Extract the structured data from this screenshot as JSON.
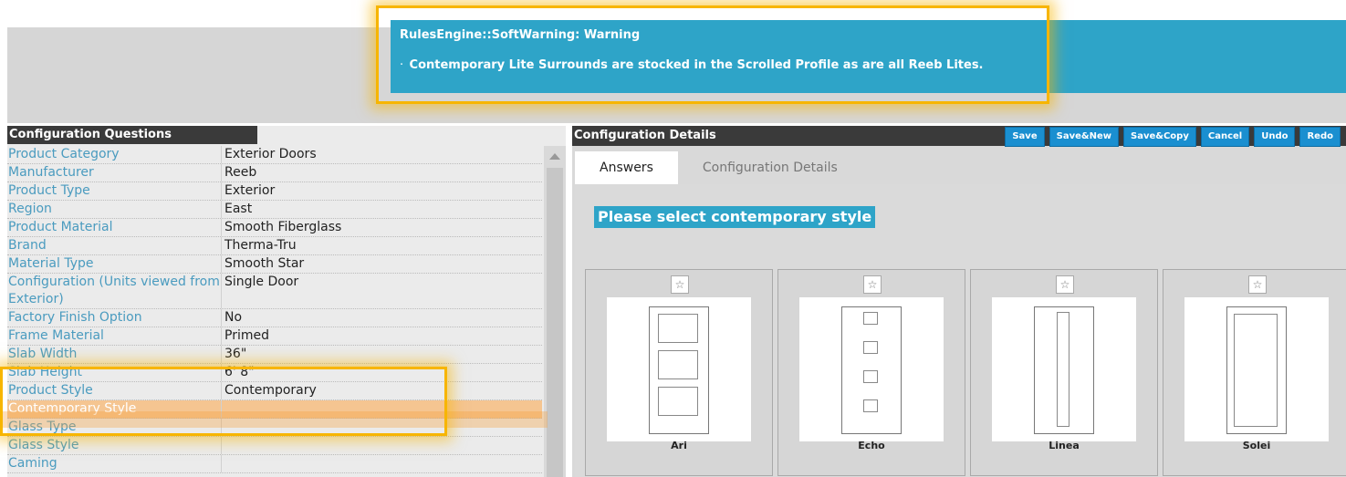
{
  "warning": {
    "title": "RulesEngine::SoftWarning: Warning",
    "message": "Contemporary Lite Surrounds are stocked in the Scrolled Profile as are all Reeb Lites."
  },
  "questions": {
    "header": "Configuration Questions",
    "rows": [
      {
        "q": "Product Category",
        "a": "Exterior Doors"
      },
      {
        "q": "Manufacturer",
        "a": "Reeb"
      },
      {
        "q": "Product Type",
        "a": "Exterior"
      },
      {
        "q": "Region",
        "a": "East"
      },
      {
        "q": "Product Material",
        "a": "Smooth Fiberglass"
      },
      {
        "q": "Brand",
        "a": "Therma-Tru"
      },
      {
        "q": "Material Type",
        "a": "Smooth Star"
      },
      {
        "q": "Configuration (Units viewed from Exterior)",
        "a": "Single Door"
      },
      {
        "q": "Factory Finish Option",
        "a": "No"
      },
      {
        "q": "Frame Material",
        "a": "Primed"
      },
      {
        "q": "Slab Width",
        "a": "36\""
      },
      {
        "q": "Slab Height",
        "a": "6' 8\""
      },
      {
        "q": "Product Style",
        "a": "Contemporary"
      },
      {
        "q": "Contemporary Style",
        "a": ""
      },
      {
        "q": "Glass Type",
        "a": ""
      },
      {
        "q": "Glass Style",
        "a": ""
      },
      {
        "q": "Caming",
        "a": ""
      }
    ]
  },
  "details": {
    "header": "Configuration Details",
    "buttons": [
      "Save",
      "Save&New",
      "Save&Copy",
      "Cancel",
      "Undo",
      "Redo"
    ],
    "tabs": [
      "Answers",
      "Configuration Details"
    ],
    "prompt": "Please select contemporary style",
    "star_glyph": "☆",
    "options": [
      {
        "name": "Ari"
      },
      {
        "name": "Echo"
      },
      {
        "name": "Linea"
      },
      {
        "name": "Solei"
      }
    ]
  },
  "colors": {
    "accent": "#2ea4c8",
    "button": "#1a8fd0",
    "header": "#3a3a3a",
    "highlight": "#f7b500",
    "selected_row": "#f5c591"
  }
}
